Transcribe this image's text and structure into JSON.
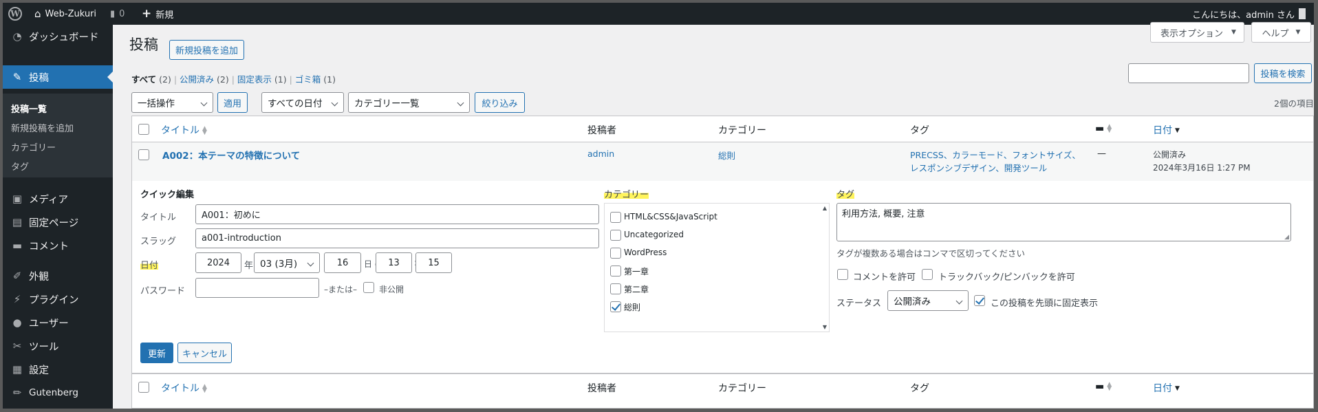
{
  "adminbar": {
    "site_name": "Web-Zukuri",
    "comments_count": "0",
    "new_label": "新規",
    "greeting": "こんにちは、admin さん"
  },
  "sidebar": {
    "items": [
      {
        "label": "ダッシュボード",
        "icon": "dashboard-icon"
      },
      {
        "label": "投稿",
        "icon": "pin-icon"
      },
      {
        "label": "メディア",
        "icon": "media-icon"
      },
      {
        "label": "固定ページ",
        "icon": "page-icon"
      },
      {
        "label": "コメント",
        "icon": "comment-icon"
      },
      {
        "label": "外観",
        "icon": "brush-icon"
      },
      {
        "label": "プラグイン",
        "icon": "plugin-icon"
      },
      {
        "label": "ユーザー",
        "icon": "user-icon"
      },
      {
        "label": "ツール",
        "icon": "wrench-icon"
      },
      {
        "label": "設定",
        "icon": "settings-icon"
      },
      {
        "label": "Gutenberg",
        "icon": "pencil-icon"
      }
    ],
    "submenu": [
      "投稿一覧",
      "新規投稿を追加",
      "カテゴリー",
      "タグ"
    ]
  },
  "header": {
    "title": "投稿",
    "add_new": "新規投稿を追加",
    "screen_options": "表示オプション",
    "help": "ヘルプ"
  },
  "filters": {
    "all": "すべて",
    "all_count": "(2)",
    "published": "公開済み",
    "published_count": "(2)",
    "sticky": "固定表示",
    "sticky_count": "(1)",
    "trash": "ゴミ箱",
    "trash_count": "(1)"
  },
  "search": {
    "placeholder": "",
    "button": "投稿を検索"
  },
  "toolbar": {
    "bulk": "一括操作",
    "apply": "適用",
    "dates": "すべての日付",
    "categories": "カテゴリー一覧",
    "filter": "絞り込み",
    "item_count": "2個の項目"
  },
  "columns": {
    "title": "タイトル",
    "author": "投稿者",
    "category": "カテゴリー",
    "tags": "タグ",
    "date": "日付"
  },
  "row": {
    "title": "A002：本テーマの特徴について",
    "author": "admin",
    "category": "総則",
    "tags_line1": "PRECSS、カラーモード、フォントサイズ、",
    "tags_line2": "レスポンシブデザイン、開発ツール",
    "comments": "—",
    "status": "公開済み",
    "datetime": "2024年3月16日 1:27 PM"
  },
  "quick_edit": {
    "heading": "クイック編集",
    "title_label": "タイトル",
    "title_value": "A001：初めに",
    "slug_label": "スラッグ",
    "slug_value": "a001-introduction",
    "date_label": "日付",
    "year": "2024",
    "year_suffix": "年",
    "month": "03 (3月)",
    "day": "16",
    "day_suffix": "日 @",
    "hour": "13",
    "colon": ":",
    "minute": "15",
    "password_label": "パスワード",
    "or_label": "–または–",
    "private_label": "非公開",
    "category_heading": "カテゴリー",
    "categories": [
      {
        "label": "HTML&CSS&JavaScript",
        "checked": false
      },
      {
        "label": "Uncategorized",
        "checked": false
      },
      {
        "label": "WordPress",
        "checked": false
      },
      {
        "label": "第一章",
        "checked": false
      },
      {
        "label": "第二章",
        "checked": false
      },
      {
        "label": "総則",
        "checked": true
      }
    ],
    "tags_heading": "タグ",
    "tags_value": "利用方法, 概要, 注意",
    "tags_hint": "タグが複数ある場合はコンマで区切ってください",
    "allow_comments": "コメントを許可",
    "allow_pings": "トラックバック/ピンバックを許可",
    "status_label": "ステータス",
    "status_value": "公開済み",
    "sticky_label": "この投稿を先頭に固定表示",
    "update": "更新",
    "cancel": "キャンセル"
  },
  "colors": {
    "accent": "#2271b1",
    "sidebar": "#1d2327",
    "highlight": "#fff45c"
  }
}
